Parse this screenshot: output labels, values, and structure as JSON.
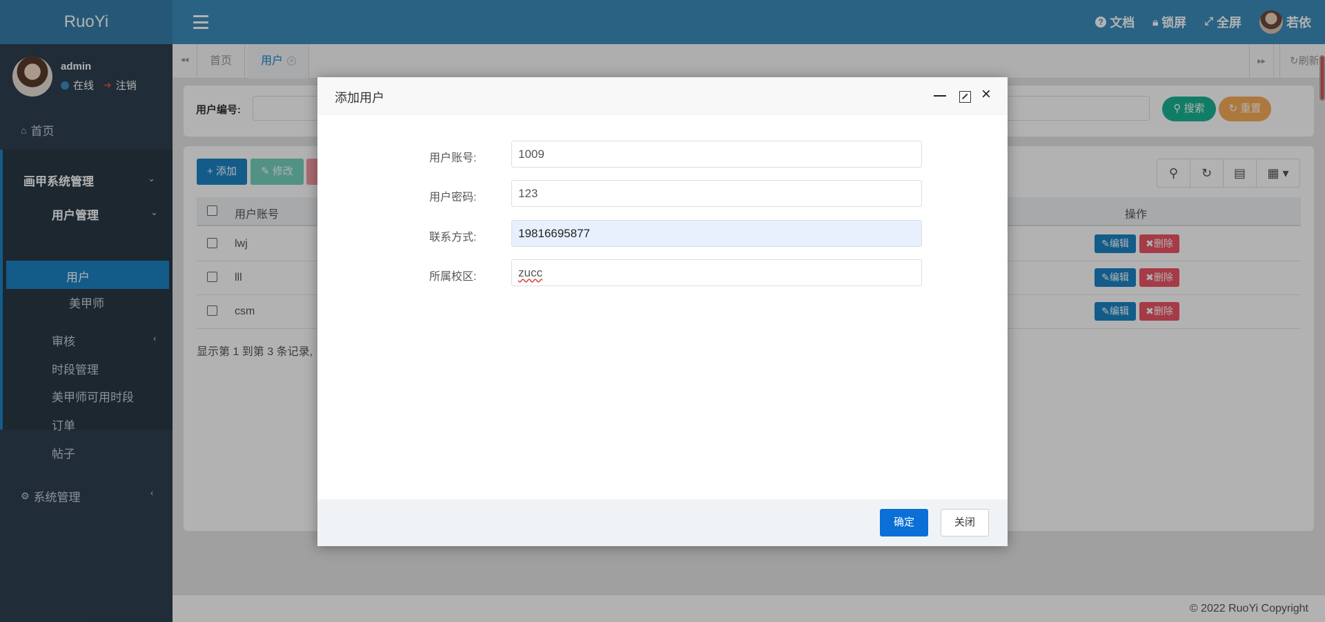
{
  "header": {
    "logo": "RuoYi",
    "doc_label": "文档",
    "lock_label": "锁屏",
    "fullscreen_label": "全屏",
    "user_name": "若依",
    "color": "#3c8dbc"
  },
  "sidebar": {
    "user": {
      "name": "admin",
      "online": "在线",
      "logout": "注销"
    },
    "home": "首页",
    "group_title": "画甲系统管理",
    "sub_title": "用户管理",
    "active_item": "用户",
    "item_artist": "美甲师",
    "audit": "审核",
    "timeslot": "时段管理",
    "artist_slots": "美甲师可用时段",
    "orders": "订单",
    "posts": "帖子",
    "system": "系统管理"
  },
  "tabs": {
    "items": [
      {
        "label": "首页"
      },
      {
        "label": "用户"
      }
    ],
    "refresh": "刷新"
  },
  "search": {
    "label": "用户编号:",
    "search_btn": "搜索",
    "reset_btn": "重置"
  },
  "toolbar": {
    "add": "添加",
    "edit": "修改"
  },
  "table": {
    "col_account": "用户账号",
    "col_ops": "操作",
    "edit_label": "编辑",
    "delete_label": "删除",
    "rows": [
      {
        "account": "lwj"
      },
      {
        "account": "lll"
      },
      {
        "account": "csm"
      }
    ],
    "page_info": "显示第 1 到第 3 条记录,"
  },
  "modal": {
    "title": "添加用户",
    "fields": {
      "account_label": "用户账号:",
      "account_value": "1009",
      "password_label": "用户密码:",
      "password_value": "123",
      "contact_label": "联系方式:",
      "contact_value": "19816695877",
      "campus_label": "所属校区:",
      "campus_value": "zucc"
    },
    "confirm": "确定",
    "close": "关闭"
  },
  "footer": {
    "copyright": "© 2022 RuoYi Copyright"
  }
}
